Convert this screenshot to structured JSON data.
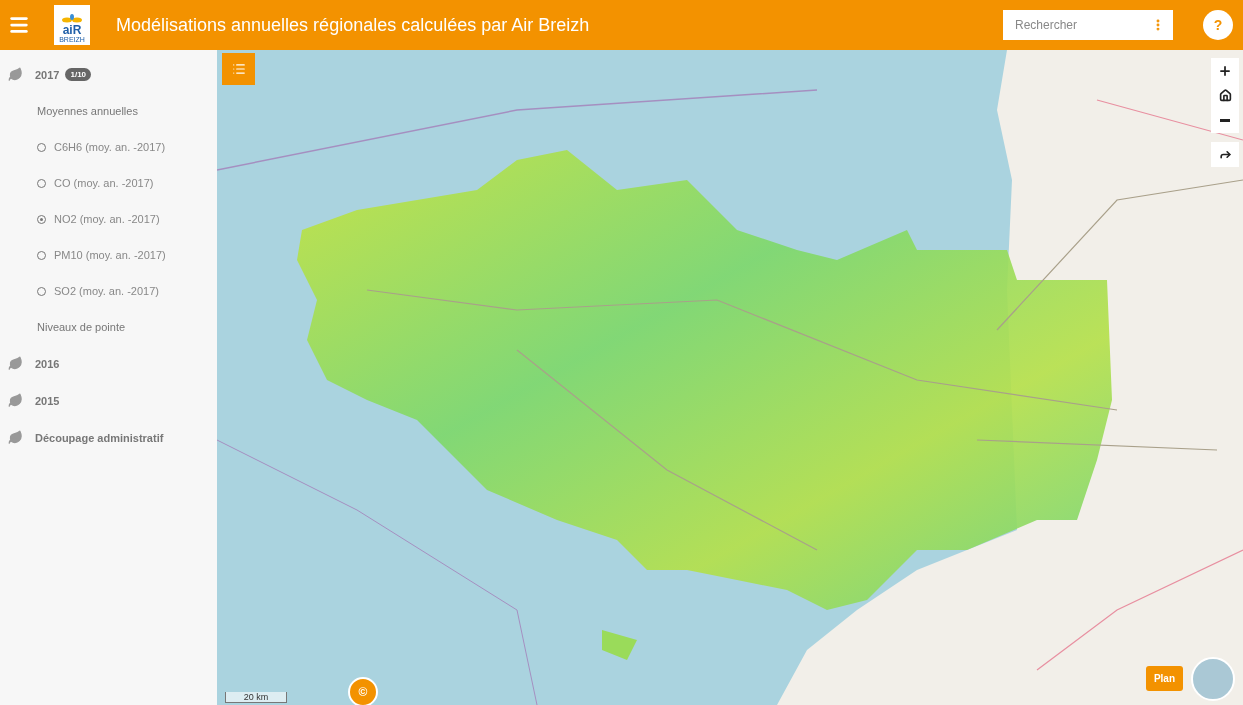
{
  "header": {
    "title": "Modélisations annuelles régionales calculées par Air Breizh",
    "logo": {
      "text": "aiR",
      "subtext": "BREIZH"
    },
    "search": {
      "placeholder": "Rechercher"
    },
    "help": "?"
  },
  "sidebar": {
    "groups": [
      {
        "label": "2017",
        "badge": "1/10",
        "children": [
          {
            "kind": "heading",
            "label": "Moyennes annuelles"
          },
          {
            "kind": "radio",
            "label": "C6H6 (moy. an. -2017)",
            "selected": false
          },
          {
            "kind": "radio",
            "label": "CO (moy. an. -2017)",
            "selected": false
          },
          {
            "kind": "radio",
            "label": "NO2 (moy. an. -2017)",
            "selected": true
          },
          {
            "kind": "radio",
            "label": "PM10 (moy. an. -2017)",
            "selected": false
          },
          {
            "kind": "radio",
            "label": "SO2 (moy. an. -2017)",
            "selected": false
          },
          {
            "kind": "heading",
            "label": "Niveaux de pointe"
          }
        ]
      },
      {
        "label": "2016"
      },
      {
        "label": "2015"
      },
      {
        "label": "Découpage administratif"
      }
    ]
  },
  "map": {
    "scale": "20 km",
    "attribution": "©",
    "basemap": "Plan"
  }
}
